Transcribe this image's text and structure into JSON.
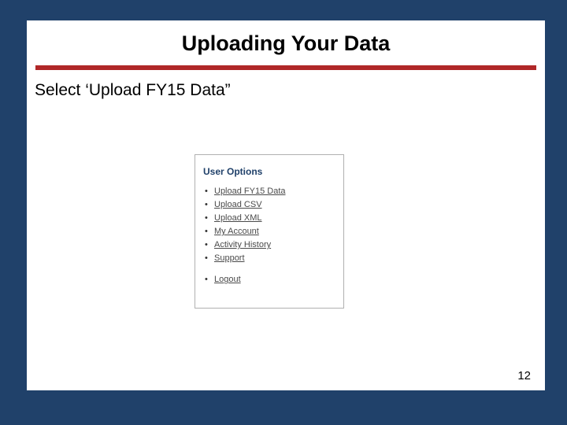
{
  "title": "Uploading Your Data",
  "instruction": "Select ‘Upload FY15 Data”",
  "options": {
    "heading": "User Options",
    "items": [
      "Upload FY15 Data",
      "Upload CSV",
      "Upload XML",
      "My Account",
      "Activity History",
      "Support"
    ],
    "logout": "Logout"
  },
  "page_number": "12"
}
